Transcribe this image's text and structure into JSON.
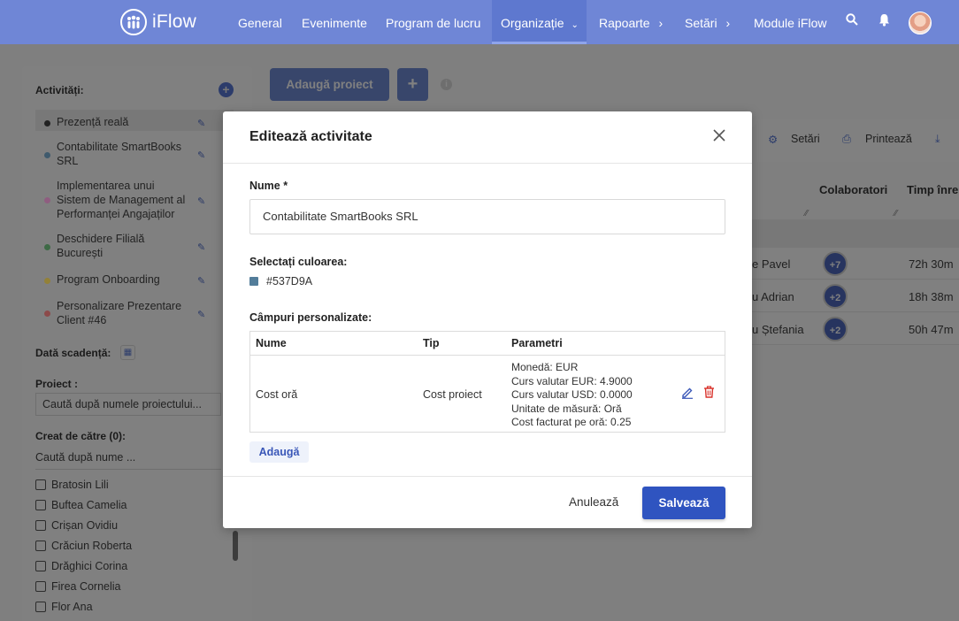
{
  "nav": {
    "logo_text": "iFlow",
    "items": [
      "General",
      "Evenimente",
      "Program de lucru",
      "Organizație",
      "Rapoarte",
      "Setări",
      "Module iFlow"
    ]
  },
  "sidebar": {
    "activities_title": "Activități:",
    "activities": [
      {
        "label": "Prezență reală",
        "color": "#222222"
      },
      {
        "label": "Contabilitate SmartBooks SRL",
        "color": "#537D9A"
      },
      {
        "label": "Implementarea unui Sistem de Management al Performanței Angajaților",
        "color": "#e58bc9"
      },
      {
        "label": "Deschidere Filială București",
        "color": "#4aa65f"
      },
      {
        "label": "Program Onboarding",
        "color": "#f2c94c"
      },
      {
        "label": "Personalizare Prezentare Client #46",
        "color": "#e26a6a"
      }
    ],
    "due_date_label": "Dată scadență:",
    "project_label": "Proiect :",
    "project_placeholder": "Caută după numele proiectului...",
    "created_by_label": "Creat de către (0):",
    "created_by_placeholder": "Caută după nume ...",
    "users": [
      "Bratosin Lili",
      "Buftea Camelia",
      "Crișan Ovidiu",
      "Crăciun Roberta",
      "Drăghici Corina",
      "Firea Cornelia",
      "Flor Ana"
    ]
  },
  "main": {
    "add_project_button": "Adaugă proiect",
    "toolbar": {
      "settings": "Setări",
      "print": "Printează"
    },
    "headers": {
      "collaborators": "Colaboratori",
      "time": "Timp înre"
    },
    "rows": [
      {
        "name": "e Pavel",
        "badge": "+7",
        "time": "72h 30m"
      },
      {
        "name": "u Adrian",
        "badge": "+2",
        "time": "18h 38m"
      },
      {
        "name": "u Ștefania",
        "badge": "+2",
        "time": "50h 47m"
      }
    ]
  },
  "modal": {
    "title": "Editează activitate",
    "name_label": "Nume *",
    "name_value": "Contabilitate SmartBooks SRL",
    "color_label": "Selectați culoarea:",
    "color_value": "#537D9A",
    "custom_fields_label": "Câmpuri personalizate:",
    "table_headers": {
      "name": "Nume",
      "type": "Tip",
      "params": "Parametri"
    },
    "row": {
      "name": "Cost oră",
      "type": "Cost proiect",
      "params": [
        "Monedă: EUR",
        "Curs valutar EUR: 4.9000",
        "Curs valutar USD: 0.0000",
        "Unitate de măsură: Oră",
        "Cost facturat pe oră: 0.25"
      ]
    },
    "add_button": "Adaugă",
    "cancel_button": "Anulează",
    "save_button": "Salvează"
  }
}
